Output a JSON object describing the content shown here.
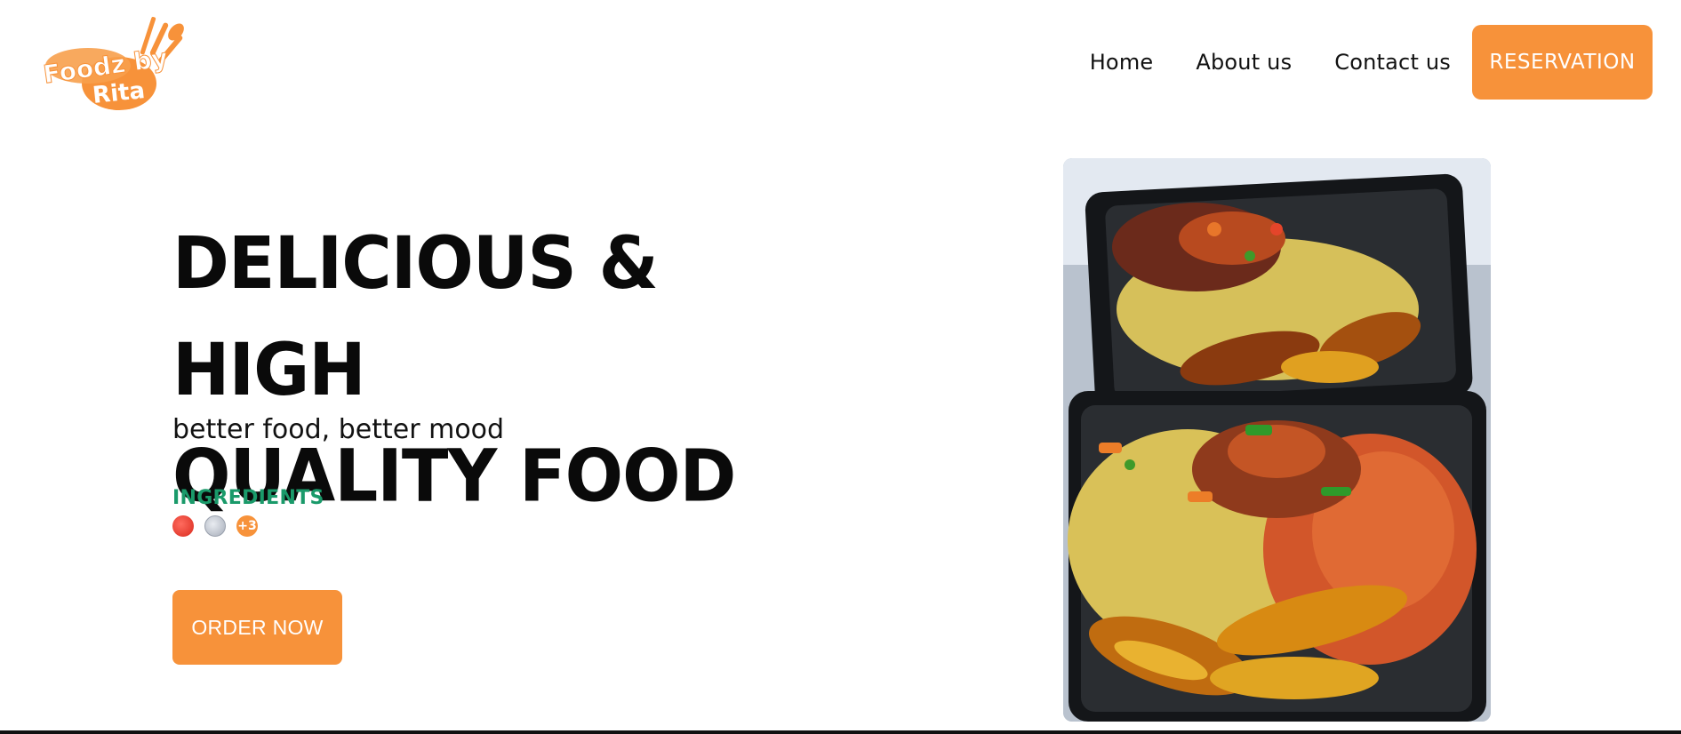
{
  "brand": {
    "logo_line1": "Foodz by",
    "logo_line2": "Rita",
    "accent_color": "#f7923a",
    "green_color": "#1a9a6a"
  },
  "nav": {
    "items": [
      {
        "label": "Home"
      },
      {
        "label": "About us"
      },
      {
        "label": "Contact us"
      }
    ],
    "cta_label": "RESERVATION"
  },
  "hero": {
    "title_line1": "Delicious & HIGH",
    "title_line2": "quality food",
    "subtitle": "better food, better mood",
    "ingredients_label": "INGREDIENTS",
    "ingredients_icons": [
      "tomato-icon",
      "onion-icon"
    ],
    "ingredients_more": "+3",
    "order_label": "ORDER NOW"
  }
}
